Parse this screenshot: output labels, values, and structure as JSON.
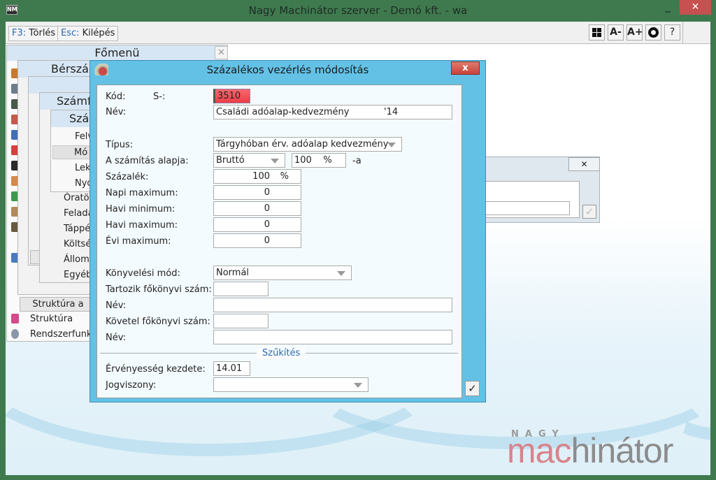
{
  "window": {
    "title": "Nagy Machinátor szerver - Demó kft. - wa",
    "icon": "NM",
    "minimize": "_",
    "maximize": "□",
    "close": "✕"
  },
  "toolbar": {
    "delete_key": "F3:",
    "delete_label": "Törlés",
    "exit_key": "Esc:",
    "exit_label": "Kilépés",
    "icons": {
      "grid": "grid-icon",
      "font_smaller": "A-",
      "font_larger": "A+",
      "power": "power-icon",
      "help": "?"
    }
  },
  "background": {
    "main_menu": {
      "title": "Főmenü",
      "close": "✕",
      "items": [
        "Struktúra a",
        "Struktúra",
        "Rendszerfunko"
      ]
    },
    "payroll": {
      "title": "Bérszán"
    },
    "accounting": {
      "title": "Számf",
      "items": [
        "Óratö",
        "Feladá",
        "Táppé",
        "Költsé",
        "Álloma",
        "Egyéb"
      ]
    },
    "percent": {
      "title": "Száz",
      "items": [
        "Felv",
        "Mó",
        "Lek",
        "Nyo"
      ]
    },
    "small_dialog": {
      "close": "✕",
      "check": "✓"
    }
  },
  "dialog": {
    "title": "Százalékos vezérlés módosítás",
    "close": "x",
    "kod_label": "Kód:",
    "kod_prefix": "S-:",
    "kod_value": "3510",
    "nev_label": "Név:",
    "nev_value": "Családi adóalap-kedvezmény            '14",
    "tipus_label": "Típus:",
    "tipus_value": "Tárgyhóban érv. adóalap kedvezmény",
    "alap_label": "A számítás alapja:",
    "alap_value": "Bruttó",
    "alap_percent": "100    %",
    "alap_suffix": "-a",
    "szazalek_label": "Százalék:",
    "szazalek_value": "100",
    "szazalek_unit": "%",
    "napi_max_label": "Napi maximum:",
    "napi_max_value": "0",
    "havi_min_label": "Havi minimum:",
    "havi_min_value": "0",
    "havi_max_label": "Havi maximum:",
    "havi_max_value": "0",
    "evi_max_label": "Évi maximum:",
    "evi_max_value": "0",
    "konyv_mod_label": "Könyvelési mód:",
    "konyv_mod_value": "Normál",
    "tartozik_label": "Tartozik főkönyvi szám:",
    "tartozik_value": "",
    "tartozik_nev_label": "Név:",
    "tartozik_nev_value": "",
    "kovetel_label": "Követel főkönyvi szám:",
    "kovetel_value": "",
    "kovetel_nev_label": "Név:",
    "kovetel_nev_value": "",
    "section": "Szűkítés",
    "ervenyes_label": "Érvényesség kezdete:",
    "ervenyes_value": "14.01",
    "jogviszony_label": "Jogviszony:",
    "jogviszony_value": "",
    "ok": "✓"
  },
  "logo": {
    "top": "NAGY",
    "brand_a": "mac",
    "brand_b": "hinátor"
  },
  "colors": {
    "frame": "#3f7a4f",
    "dialog_title": "#63c1e6",
    "kod_field": "#f0525a",
    "accent_text": "#2a6ab0",
    "logo_pink": "#d9838b"
  }
}
